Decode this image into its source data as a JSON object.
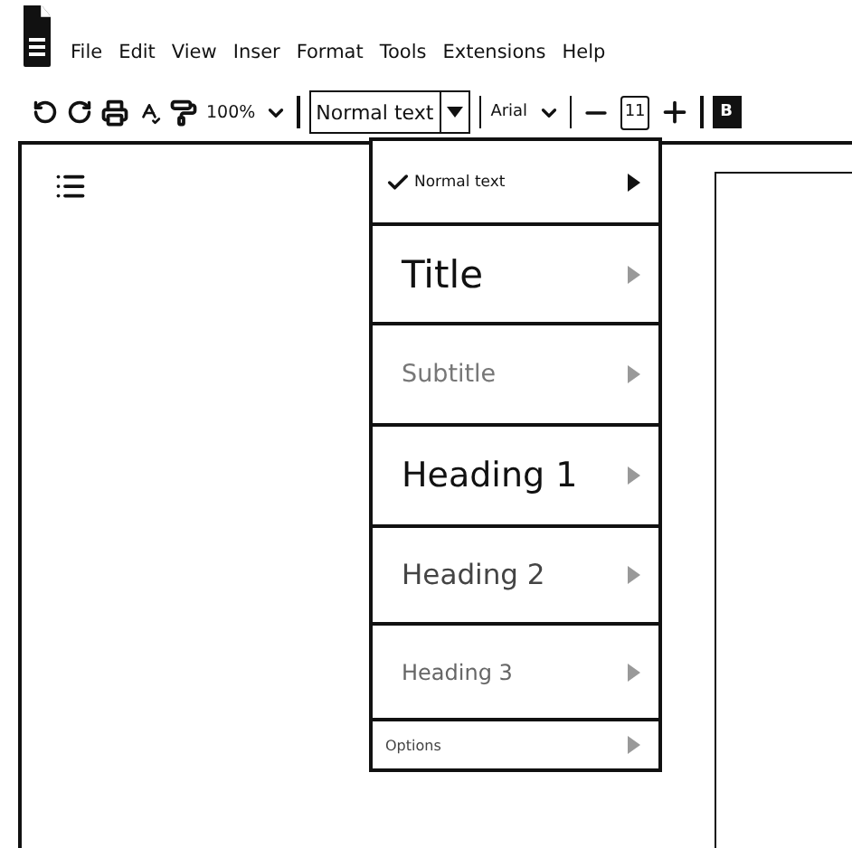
{
  "menu": [
    "File",
    "Edit",
    "View",
    "Inser",
    "Format",
    "Tools",
    "Extensions",
    "Help"
  ],
  "toolbar": {
    "zoom": "100%",
    "style": "Normal text",
    "font": "Arial",
    "size": "11",
    "bold": "B"
  },
  "style_menu": {
    "items": [
      {
        "label": "Normal text",
        "kind": "normal",
        "selected": true
      },
      {
        "label": "Title",
        "kind": "title",
        "selected": false
      },
      {
        "label": "Subtitle",
        "kind": "subtitle",
        "selected": false
      },
      {
        "label": "Heading 1",
        "kind": "heading1",
        "selected": false
      },
      {
        "label": "Heading 2",
        "kind": "heading2",
        "selected": false
      },
      {
        "label": "Heading 3",
        "kind": "heading3",
        "selected": false
      },
      {
        "label": "Options",
        "kind": "options",
        "selected": false
      }
    ]
  }
}
